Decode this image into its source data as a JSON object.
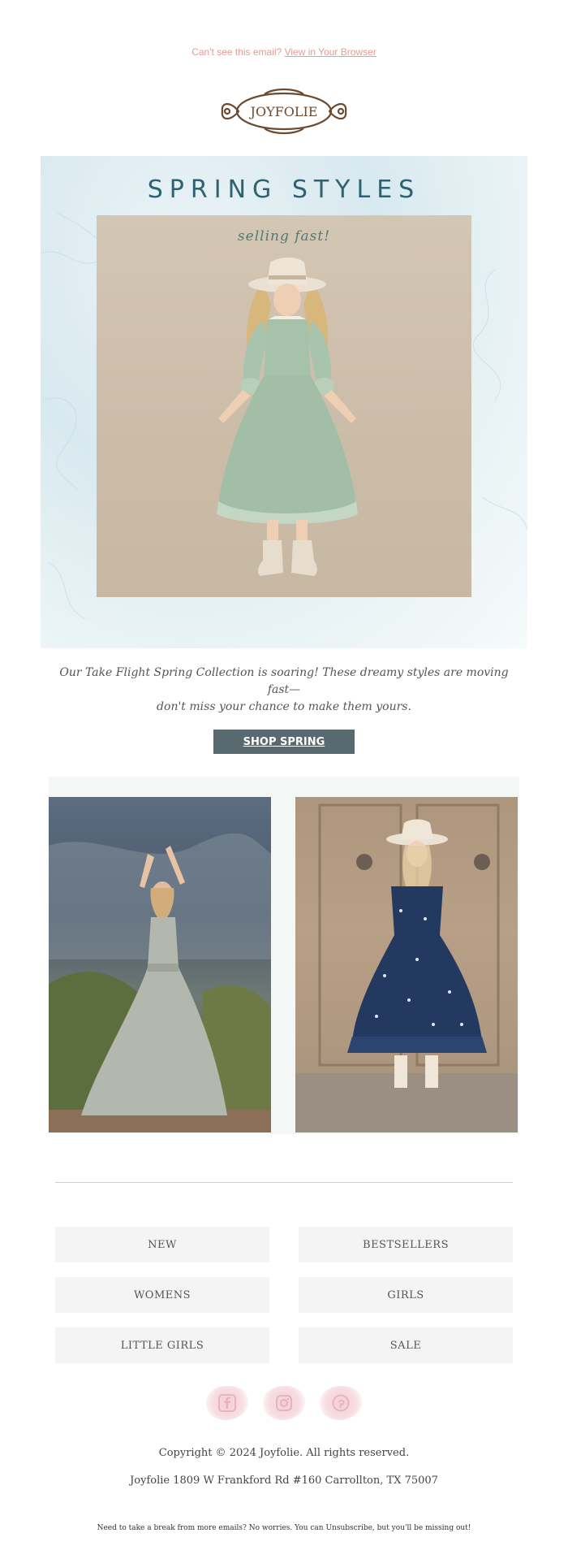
{
  "preheader": {
    "text": "Can't see this email?",
    "link_label": "View in Your Browser"
  },
  "brand": {
    "logo_text": "JOYFOLIE",
    "color": "#6b4a2f"
  },
  "hero": {
    "title": "SPRING STYLES",
    "subtitle": "selling fast!",
    "title_color": "#2b6372"
  },
  "body_copy": {
    "line1": "Our Take Flight Spring Collection is soaring! These dreamy styles are moving fast—",
    "line2": "don't miss your chance to make them yours."
  },
  "cta": {
    "label": "SHOP SPRING",
    "color": "#586a6f"
  },
  "nav": {
    "items": [
      {
        "label": "NEW"
      },
      {
        "label": "BESTSELLERS"
      },
      {
        "label": "WOMENS"
      },
      {
        "label": "GIRLS"
      },
      {
        "label": "LITTLE GIRLS"
      },
      {
        "label": "SALE"
      }
    ]
  },
  "social": {
    "icons": [
      "facebook-icon",
      "instagram-icon",
      "pinterest-icon"
    ]
  },
  "footer": {
    "copyright": "Copyright © 2024 Joyfolie. All rights reserved.",
    "address": "Joyfolie 1809 W Frankford Rd #160 Carrollton, TX 75007",
    "unsubscribe": "Need to take a break from more emails? No worries. You can Unsubscribe, but you'll be missing out!"
  }
}
